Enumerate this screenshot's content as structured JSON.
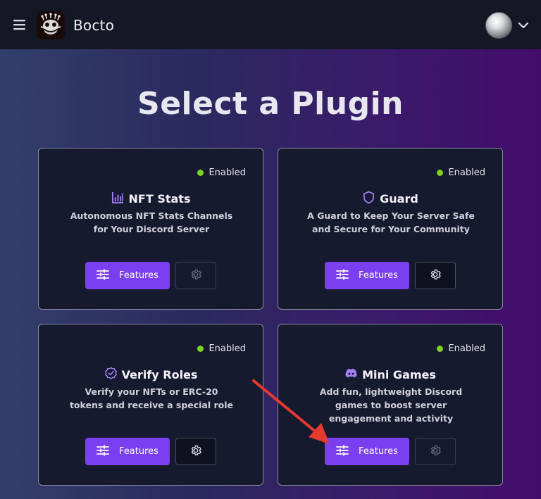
{
  "app": {
    "brand": "Bocto"
  },
  "page": {
    "title": "Select a Plugin"
  },
  "plugins": [
    {
      "name": "NFT Stats",
      "icon": "bar-chart-icon",
      "status": "Enabled",
      "description": "Autonomous NFT Stats Channels for Your Discord Server",
      "features_label": "Features"
    },
    {
      "name": "Guard",
      "icon": "shield-icon",
      "status": "Enabled",
      "description": "A Guard to Keep Your Server Safe and Secure for Your Community",
      "features_label": "Features"
    },
    {
      "name": "Verify Roles",
      "icon": "verified-badge-icon",
      "status": "Enabled",
      "description": "Verify your NFTs or ERC-20 tokens and receive a special role",
      "features_label": "Features"
    },
    {
      "name": "Mini Games",
      "icon": "discord-icon",
      "status": "Enabled",
      "description": "Add fun, lightweight Discord games to boost server engagement and activity",
      "features_label": "Features"
    }
  ],
  "colors": {
    "accent": "#7b3ff2",
    "status_enabled": "#7ed321",
    "annotation_arrow": "#e53a2f"
  }
}
